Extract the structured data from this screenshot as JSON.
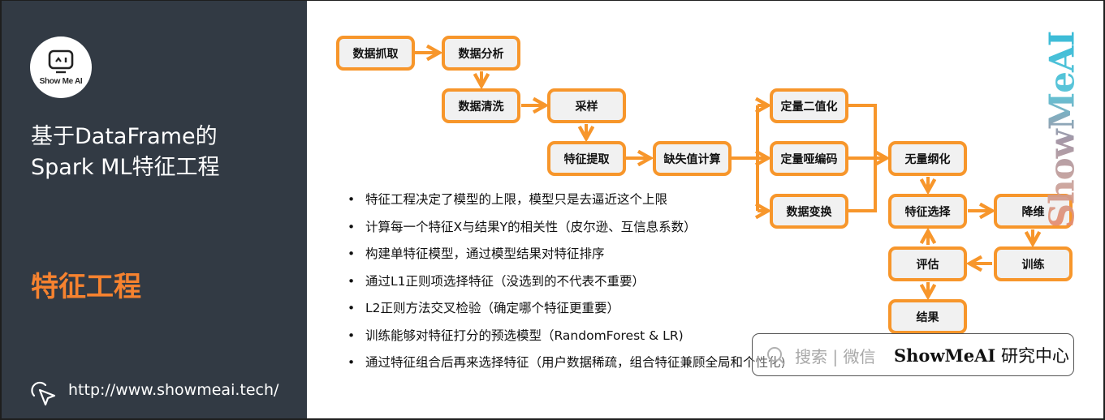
{
  "sidebar": {
    "logo_text": "Show Me AI",
    "title_line1": "基于DataFrame的",
    "title_line2": "Spark ML特征工程",
    "section": "特征工程",
    "url": "http://www.showmeai.tech/",
    "colors": {
      "background": "#323a44",
      "accent": "#f6822f"
    }
  },
  "diagram": {
    "accent_color": "#f7962b",
    "nodes": {
      "crawl": "数据抓取",
      "analyze": "数据分析",
      "clean": "数据清洗",
      "sample": "采样",
      "extract": "特征提取",
      "missing": "缺失值计算",
      "binarize": "定量二值化",
      "dummy": "定量哑编码",
      "transform": "数据变换",
      "normalize": "无量纲化",
      "select": "特征选择",
      "reduce": "降维",
      "train": "训练",
      "evaluate": "评估",
      "result": "结果"
    },
    "edges": [
      [
        "数据抓取",
        "数据分析"
      ],
      [
        "数据分析",
        "数据清洗"
      ],
      [
        "数据清洗",
        "采样"
      ],
      [
        "采样",
        "特征提取"
      ],
      [
        "特征提取",
        "缺失值计算"
      ],
      [
        "缺失值计算",
        "定量二值化"
      ],
      [
        "缺失值计算",
        "定量哑编码"
      ],
      [
        "缺失值计算",
        "数据变换"
      ],
      [
        "定量二值化",
        "无量纲化"
      ],
      [
        "定量哑编码",
        "无量纲化"
      ],
      [
        "数据变换",
        "无量纲化"
      ],
      [
        "无量纲化",
        "特征选择"
      ],
      [
        "特征选择",
        "降维"
      ],
      [
        "降维",
        "训练"
      ],
      [
        "训练",
        "评估"
      ],
      [
        "评估",
        "特征选择"
      ],
      [
        "评估",
        "结果"
      ]
    ]
  },
  "bullets": [
    "特征工程决定了模型的上限，模型只是去逼近这个上限",
    "计算每一个特征X与结果Y的相关性（皮尔逊、互信息系数）",
    "构建单特征模型，通过模型结果对特征排序",
    "通过L1正则项选择特征（没选到的不代表不重要）",
    "L2正则方法交叉检验（确定哪个特征更重要）",
    "训练能够对特征打分的预选模型（RandomForest & LR)",
    "通过特征组合后再来选择特征（用户数据稀疏，组合特征兼顾全局和个性化)"
  ],
  "watermark": "ShowMeAI",
  "search_box": {
    "hint": "搜索 | 微信",
    "brand": "ShowMeAI",
    "brand_suffix": "研究中心"
  }
}
